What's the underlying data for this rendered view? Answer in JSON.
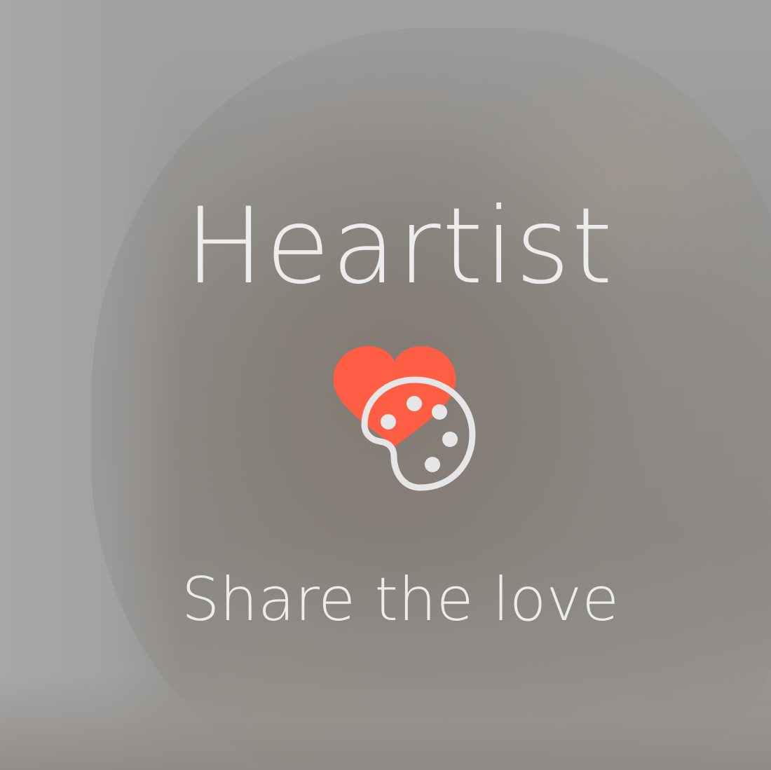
{
  "app": {
    "title": "Heartist",
    "tagline": "Share the love"
  },
  "logo": {
    "icon": "heart-palette-icon",
    "heart_color": "#ff5d44",
    "palette_color": "#e6e6e6"
  }
}
